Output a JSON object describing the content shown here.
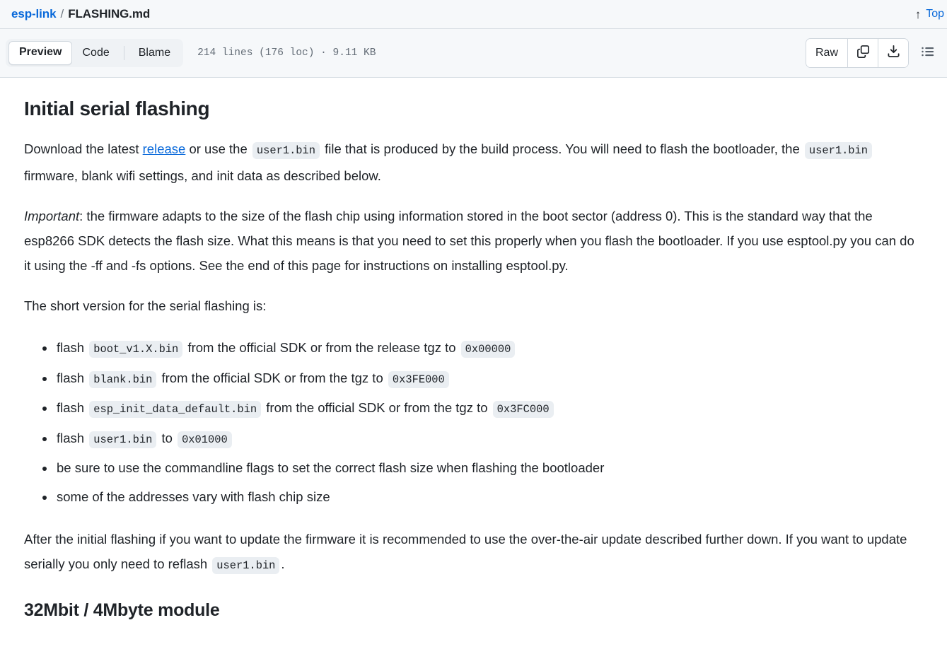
{
  "breadcrumb": {
    "repo": "esp-link",
    "separator": "/",
    "file": "FLASHING.md"
  },
  "top_link": {
    "label": "Top",
    "arrow": "↑",
    "icon": "arrow-up-icon"
  },
  "toolbar": {
    "tabs": [
      {
        "label": "Preview",
        "active": true
      },
      {
        "label": "Code",
        "active": false
      },
      {
        "label": "Blame",
        "active": false
      }
    ],
    "file_stats": "214 lines (176 loc) · 9.11 KB",
    "raw_label": "Raw",
    "icons": {
      "copy": "copy-icon",
      "download": "download-icon",
      "outline": "outline-list-icon"
    }
  },
  "document": {
    "heading1": "Initial serial flashing",
    "para1": {
      "t1": "Download the latest ",
      "link": "release",
      "t2": " or use the ",
      "code1": "user1.bin",
      "t3": " file that is produced by the build process. You will need to flash the bootloader, the ",
      "code2": "user1.bin",
      "t4": " firmware, blank wifi settings, and init data as described below."
    },
    "para2": {
      "emphasis": "Important",
      "text": ": the firmware adapts to the size of the flash chip using information stored in the boot sector (address 0). This is the standard way that the esp8266 SDK detects the flash size. What this means is that you need to set this properly when you flash the bootloader. If you use esptool.py you can do it using the -ff and -fs options. See the end of this page for instructions on installing esptool.py."
    },
    "para3": "The short version for the serial flashing is:",
    "bullets": [
      {
        "pre": "flash ",
        "code1": "boot_v1.X.bin",
        "mid": " from the official SDK or from the release tgz to ",
        "code2": "0x00000",
        "post": ""
      },
      {
        "pre": "flash ",
        "code1": "blank.bin",
        "mid": " from the official SDK or from the tgz to ",
        "code2": "0x3FE000",
        "post": ""
      },
      {
        "pre": "flash ",
        "code1": "esp_init_data_default.bin",
        "mid": " from the official SDK or from the tgz to ",
        "code2": "0x3FC000",
        "post": ""
      },
      {
        "pre": "flash ",
        "code1": "user1.bin",
        "mid": " to ",
        "code2": "0x01000",
        "post": ""
      },
      {
        "pre": "be sure to use the commandline flags to set the correct flash size when flashing the bootloader",
        "code1": "",
        "mid": "",
        "code2": "",
        "post": ""
      },
      {
        "pre": "some of the addresses vary with flash chip size",
        "code1": "",
        "mid": "",
        "code2": "",
        "post": ""
      }
    ],
    "para4": {
      "t1": "After the initial flashing if you want to update the firmware it is recommended to use the over-the-air update described further down. If you want to update serially you only need to reflash ",
      "code": "user1.bin",
      "t2": "."
    },
    "heading2": "32Mbit / 4Mbyte module"
  },
  "colors": {
    "link": "#0969da",
    "header_bg": "#f6f8fa",
    "border": "#d8dee4",
    "code_bg": "#eaeef2",
    "text": "#1f2328",
    "muted": "#636c76"
  }
}
